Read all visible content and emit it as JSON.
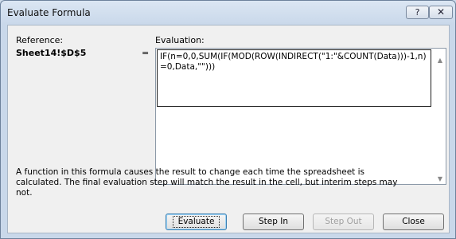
{
  "window": {
    "title": "Evaluate Formula",
    "help_label": "?",
    "close_label": "✕"
  },
  "reference": {
    "label": "Reference:",
    "value": "Sheet14!$D$5"
  },
  "equals": "=",
  "evaluation": {
    "label": "Evaluation:",
    "formula": "IF(n=0,0,SUM(IF(MOD(ROW(INDIRECT(\"1:\"&COUNT(Data)))-1,n)=0,Data,\"\")))"
  },
  "info": "A function in this formula causes the result to change each time the spreadsheet is calculated.  The final evaluation step will match the result in the cell, but interim steps may not.",
  "buttons": {
    "evaluate": "Evaluate",
    "step_in": "Step In",
    "step_out": "Step Out",
    "close": "Close"
  },
  "icons": {
    "scroll_up": "scroll-up-arrow",
    "scroll_down": "scroll-down-arrow"
  }
}
